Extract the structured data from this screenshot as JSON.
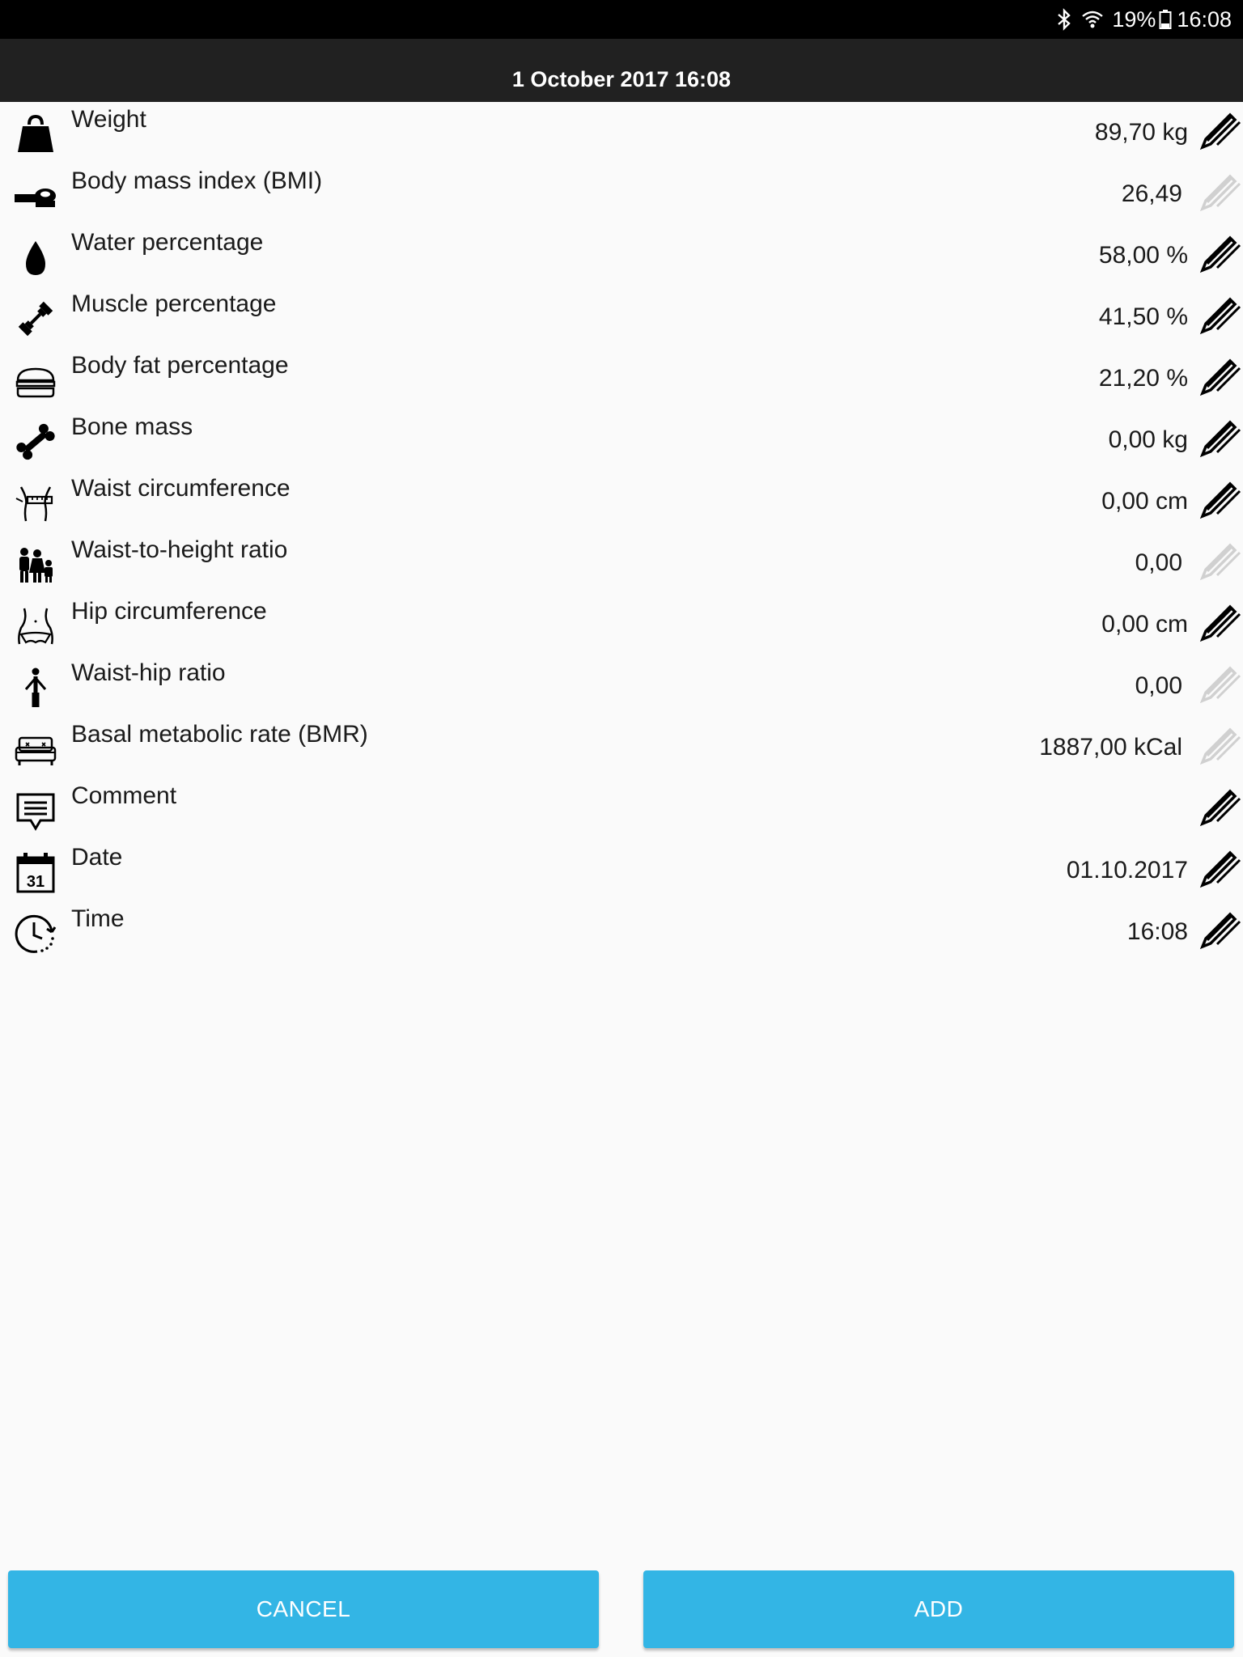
{
  "status_bar": {
    "battery_percent": "19%",
    "time": "16:08",
    "icons": [
      "bluetooth-icon",
      "wifi-icon",
      "battery-icon"
    ]
  },
  "header": {
    "title": "1 October 2017 16:08"
  },
  "measurements": [
    {
      "icon": "weight-icon",
      "label": "Weight",
      "value": "89,70 kg",
      "editable": true
    },
    {
      "icon": "tape-measure-icon",
      "label": "Body mass index (BMI)",
      "value": "26,49",
      "editable": false
    },
    {
      "icon": "water-drop-icon",
      "label": "Water percentage",
      "value": "58,00 %",
      "editable": true
    },
    {
      "icon": "dumbbell-icon",
      "label": "Muscle percentage",
      "value": "41,50 %",
      "editable": true
    },
    {
      "icon": "burger-icon",
      "label": "Body fat percentage",
      "value": "21,20 %",
      "editable": true
    },
    {
      "icon": "bone-icon",
      "label": "Bone mass",
      "value": "0,00 kg",
      "editable": true
    },
    {
      "icon": "waist-icon",
      "label": "Waist circumference",
      "value": "0,00 cm",
      "editable": true
    },
    {
      "icon": "family-icon",
      "label": "Waist-to-height ratio",
      "value": "0,00",
      "editable": false
    },
    {
      "icon": "hip-icon",
      "label": "Hip circumference",
      "value": "0,00 cm",
      "editable": true
    },
    {
      "icon": "person-icon",
      "label": "Waist-hip ratio",
      "value": "0,00",
      "editable": false
    },
    {
      "icon": "sofa-icon",
      "label": "Basal metabolic rate (BMR)",
      "value": "1887,00 kCal",
      "editable": false
    },
    {
      "icon": "comment-icon",
      "label": "Comment",
      "value": "",
      "editable": true
    },
    {
      "icon": "calendar-icon",
      "label": "Date",
      "value": "01.10.2017",
      "editable": true,
      "calendar_day": "31"
    },
    {
      "icon": "clock-icon",
      "label": "Time",
      "value": "16:08",
      "editable": true
    }
  ],
  "buttons": {
    "cancel": "CANCEL",
    "add": "ADD"
  },
  "colors": {
    "accent_button": "#33b5e5",
    "header_bg": "#212121",
    "status_bg": "#000000",
    "edit_active": "#000000",
    "edit_disabled": "#d0d0d0"
  }
}
